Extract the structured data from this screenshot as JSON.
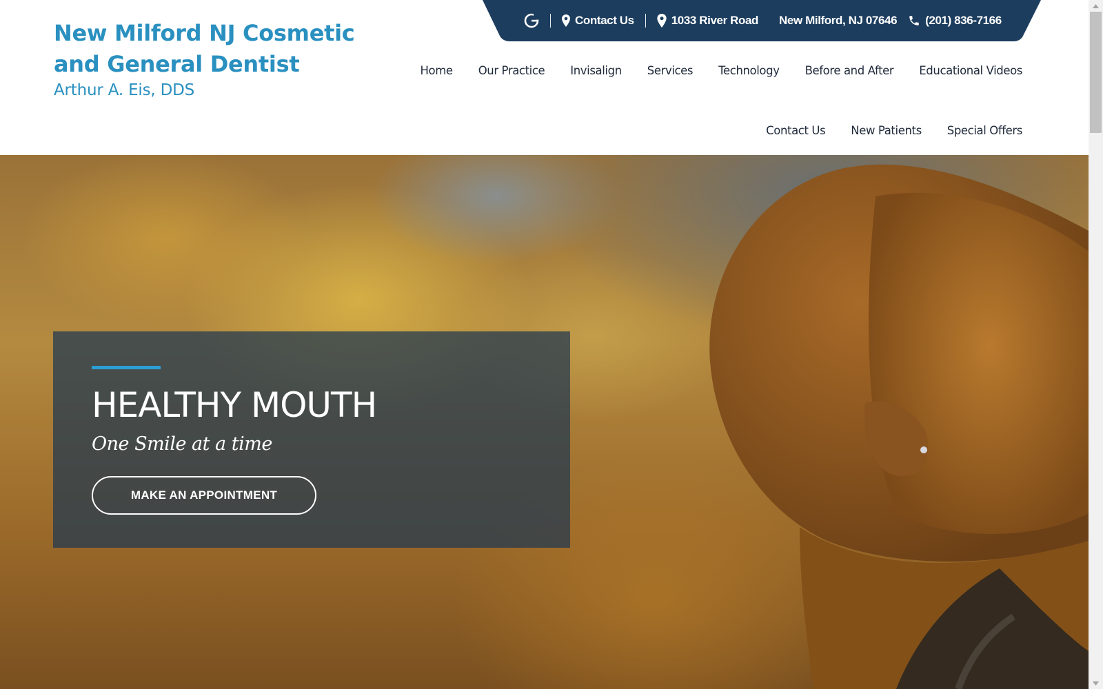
{
  "brand": {
    "title": "New Milford NJ Cosmetic and General Dentist",
    "subtitle": "Arthur A. Eis, DDS",
    "color": "#2a90c0"
  },
  "topbar": {
    "background": "#1c3d5e",
    "google_icon": "google-icon",
    "contact_label": "Contact Us",
    "address_street": "1033 River Road",
    "address_city": "New Milford, NJ 07646",
    "phone": "(201) 836-7166"
  },
  "nav": {
    "items": [
      "Home",
      "Our Practice",
      "Invisalign",
      "Services",
      "Technology",
      "Before and After",
      "Educational Videos"
    ],
    "items_row2": [
      "Contact Us",
      "New Patients",
      "Special Offers"
    ]
  },
  "hero": {
    "title": "HEALTHY MOUTH",
    "tagline": "One Smile at a time",
    "button_label": "MAKE AN APPOINTMENT",
    "accent_color": "#2a9ed4"
  }
}
